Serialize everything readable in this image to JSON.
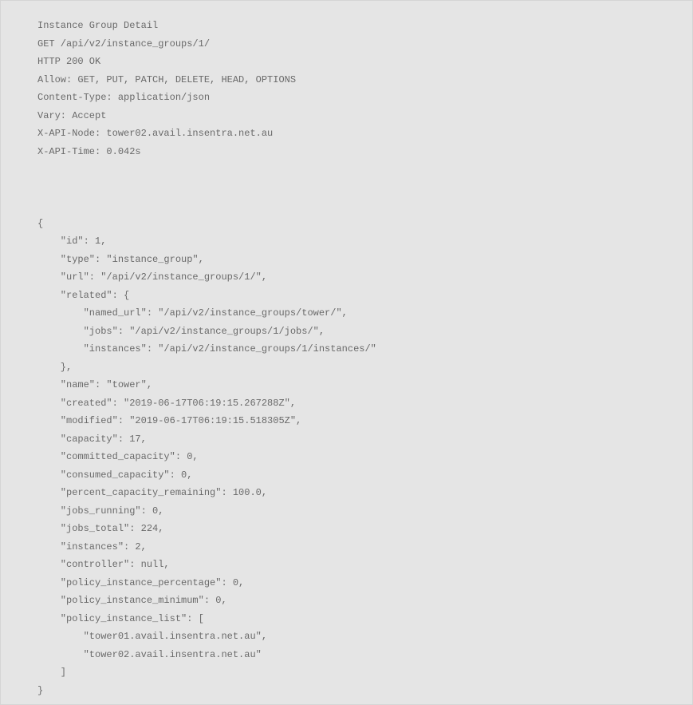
{
  "header": {
    "line1": "Instance Group Detail",
    "line2": "GET /api/v2/instance_groups/1/",
    "line3": "HTTP 200 OK",
    "line4": "Allow: GET, PUT, PATCH, DELETE, HEAD, OPTIONS",
    "line5": "Content-Type: application/json",
    "line6": "Vary: Accept",
    "line7": "X-API-Node: tower02.avail.insentra.net.au",
    "line8": "X-API-Time: 0.042s"
  },
  "body": {
    "l1": "{",
    "l2": "    \"id\": 1,",
    "l3": "    \"type\": \"instance_group\",",
    "l4": "    \"url\": \"/api/v2/instance_groups/1/\",",
    "l5": "    \"related\": {",
    "l6": "        \"named_url\": \"/api/v2/instance_groups/tower/\",",
    "l7": "        \"jobs\": \"/api/v2/instance_groups/1/jobs/\",",
    "l8": "        \"instances\": \"/api/v2/instance_groups/1/instances/\"",
    "l9": "    },",
    "l10": "    \"name\": \"tower\",",
    "l11": "    \"created\": \"2019-06-17T06:19:15.267288Z\",",
    "l12": "    \"modified\": \"2019-06-17T06:19:15.518305Z\",",
    "l13": "    \"capacity\": 17,",
    "l14": "    \"committed_capacity\": 0,",
    "l15": "    \"consumed_capacity\": 0,",
    "l16": "    \"percent_capacity_remaining\": 100.0,",
    "l17": "    \"jobs_running\": 0,",
    "l18": "    \"jobs_total\": 224,",
    "l19": "    \"instances\": 2,",
    "l20": "    \"controller\": null,",
    "l21": "    \"policy_instance_percentage\": 0,",
    "l22": "    \"policy_instance_minimum\": 0,",
    "l23": "    \"policy_instance_list\": [",
    "l24": "        \"tower01.avail.insentra.net.au\",",
    "l25": "        \"tower02.avail.insentra.net.au\"",
    "l26": "    ]",
    "l27": "}"
  }
}
